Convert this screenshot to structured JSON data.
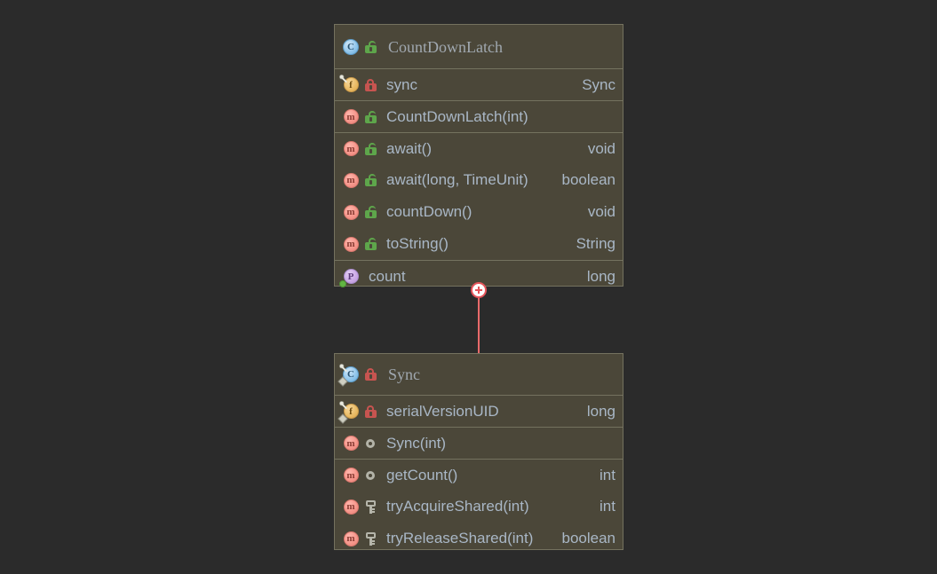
{
  "theme": {
    "background": "#2b2b2b",
    "box_fill": "#4b4739",
    "box_border": "#74725f",
    "text": "#a9b7c6",
    "title_text": "#a0a8b0",
    "edge_color": "#e96a6a"
  },
  "diagram": {
    "type": "uml-class-diagram",
    "classes": [
      {
        "id": "countdownlatch",
        "title": "CountDownLatch",
        "icon": "class-icon",
        "visibility_icon": "lock-open-green-icon",
        "sections": [
          {
            "name": "fields",
            "members": [
              {
                "name": "sync",
                "type": "Sync",
                "kind": "field",
                "kind_icon": "field-icon",
                "visibility_icon": "lock-closed-red-icon",
                "badges": [
                  "static-badge"
                ]
              }
            ]
          },
          {
            "name": "constructors",
            "members": [
              {
                "name": "CountDownLatch(int)",
                "type": "",
                "kind": "method",
                "kind_icon": "method-icon",
                "visibility_icon": "lock-open-green-icon",
                "badges": []
              }
            ]
          },
          {
            "name": "methods",
            "members": [
              {
                "name": "await()",
                "type": "void",
                "kind": "method",
                "kind_icon": "method-icon",
                "visibility_icon": "lock-open-green-icon",
                "badges": []
              },
              {
                "name": "await(long, TimeUnit)",
                "type": "boolean",
                "kind": "method",
                "kind_icon": "method-icon",
                "visibility_icon": "lock-open-green-icon",
                "badges": []
              },
              {
                "name": "countDown()",
                "type": "void",
                "kind": "method",
                "kind_icon": "method-icon",
                "visibility_icon": "lock-open-green-icon",
                "badges": []
              },
              {
                "name": "toString()",
                "type": "String",
                "kind": "method",
                "kind_icon": "method-icon",
                "visibility_icon": "lock-open-green-icon",
                "badges": []
              }
            ]
          },
          {
            "name": "properties",
            "members": [
              {
                "name": "count",
                "type": "long",
                "kind": "property",
                "kind_icon": "property-icon",
                "visibility_icon": "",
                "badges": [
                  "green-dot-badge"
                ]
              }
            ]
          }
        ]
      },
      {
        "id": "sync",
        "title": "Sync",
        "icon": "class-icon",
        "icon_badges": [
          "static-badge",
          "final-badge"
        ],
        "visibility_icon": "lock-closed-red-icon",
        "sections": [
          {
            "name": "fields",
            "members": [
              {
                "name": "serialVersionUID",
                "type": "long",
                "kind": "field",
                "kind_icon": "field-icon",
                "visibility_icon": "lock-closed-red-icon",
                "badges": [
                  "static-badge",
                  "final-badge"
                ]
              }
            ]
          },
          {
            "name": "constructors",
            "members": [
              {
                "name": "Sync(int)",
                "type": "",
                "kind": "method",
                "kind_icon": "method-icon",
                "visibility_icon": "package-private-icon",
                "badges": []
              }
            ]
          },
          {
            "name": "methods",
            "members": [
              {
                "name": "getCount()",
                "type": "int",
                "kind": "method",
                "kind_icon": "method-icon",
                "visibility_icon": "package-private-icon",
                "badges": []
              },
              {
                "name": "tryAcquireShared(int)",
                "type": "int",
                "kind": "method",
                "kind_icon": "method-icon",
                "visibility_icon": "protected-key-icon",
                "badges": []
              },
              {
                "name": "tryReleaseShared(int)",
                "type": "boolean",
                "kind": "method",
                "kind_icon": "method-icon",
                "visibility_icon": "protected-key-icon",
                "badges": []
              }
            ]
          }
        ]
      }
    ],
    "edges": [
      {
        "from": "countdownlatch",
        "to": "sync",
        "marker": "plus-circle-marker",
        "style": "solid"
      }
    ]
  }
}
